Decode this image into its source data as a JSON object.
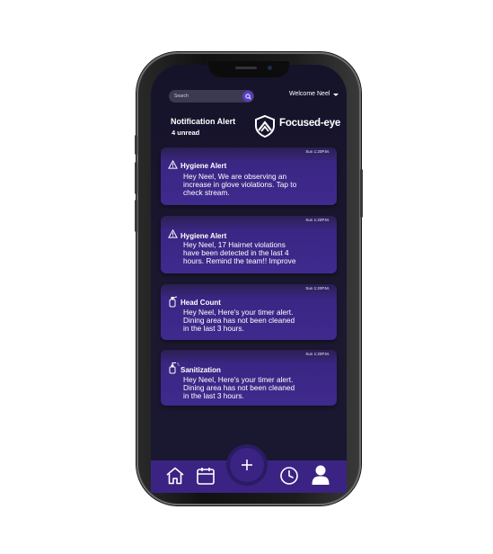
{
  "header": {
    "search_placeholder": "Search",
    "welcome": "Welcome Neel",
    "title": "Notification Alert",
    "unread": "4 unread",
    "brand": "Focused-eye"
  },
  "notifications": [
    {
      "icon": "warning-icon",
      "title": "Hygiene Alert",
      "time": "Sun 1:20P.M.",
      "body": "Hey Neel, We are observing an\nincrease in glove violations. Tap to\ncheck stream."
    },
    {
      "icon": "warning-icon",
      "title": "Hygiene Alert",
      "time": "Sun 1:20P.M.",
      "body": "Hey Neel, 17 Hairnet violations\nhave been detected in the last 4\nhours. Remind the team!! Improve"
    },
    {
      "icon": "spray-bottle-icon",
      "title": "Head Count",
      "time": "Sun 1:20P.M.",
      "body": "Hey Neel, Here's your timer alert.\nDining area  has not been cleaned\nin the last 3 hours."
    },
    {
      "icon": "sanitizer-icon",
      "title": "Sanitization",
      "time": "Sun 1:20P.M.",
      "body": "Hey Neel, Here's your timer alert.\nDining area  has not been cleaned\nin the last 3 hours."
    }
  ],
  "nav": [
    "home-icon",
    "calendar-icon",
    "add-icon",
    "clock-icon",
    "user-icon"
  ],
  "colors": {
    "accent": "#3b2384",
    "card": "#3f2a8e",
    "background": "#1b1830"
  }
}
